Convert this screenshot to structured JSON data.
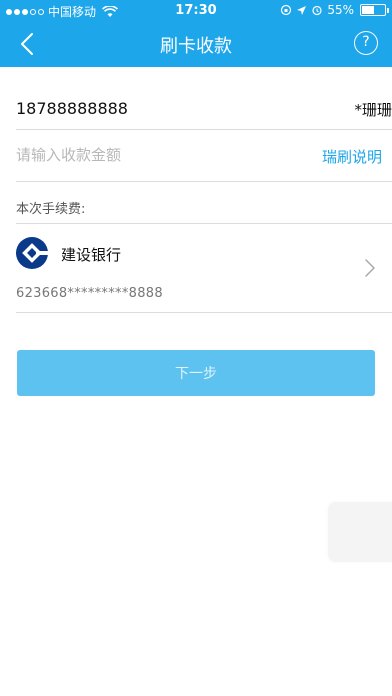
{
  "status_bar": {
    "carrier": "中国移动",
    "time": "17:30",
    "battery": "55%",
    "battery_level": 0.55,
    "signal_dots_filled": 3,
    "signal_dots_total": 5
  },
  "nav": {
    "title": "刷卡收款",
    "back_icon": "chevron-left-icon",
    "help_icon": "question-circle-icon",
    "help_label": "?"
  },
  "form": {
    "phone": "18788888888",
    "holder": "*珊珊",
    "amount_placeholder": "请输入收款金额",
    "amount_value": "",
    "guide_link": "瑞刷说明",
    "fee_label": "本次手续费:"
  },
  "bank": {
    "name": "建设银行",
    "card_number": "623668*********8888",
    "logo_icon": "ccb-logo-icon",
    "arrow_icon": "chevron-right-icon"
  },
  "next_button": "下一步",
  "colors": {
    "primary": "#1da6ea",
    "button": "#5ec2f0",
    "divider": "#dcdcdc",
    "placeholder": "#b8b8b8"
  }
}
